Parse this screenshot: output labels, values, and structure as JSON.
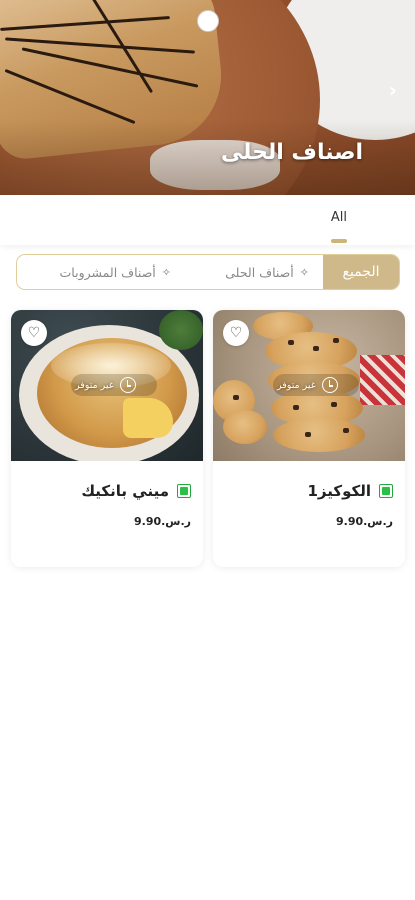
{
  "hero": {
    "title": "اصناف الحلى",
    "next_icon": "chevron-right-icon"
  },
  "tabs": [
    {
      "label": "All",
      "active": true
    }
  ],
  "filters": {
    "all_label": "الجميع",
    "items": [
      {
        "label": "أصناف الحلى",
        "icon": "sparkle-icon"
      },
      {
        "label": "أصناف المشروبات",
        "icon": "sparkle-icon"
      }
    ],
    "accent_color": "#cfb98a"
  },
  "products": [
    {
      "name": "ميني بانكيك",
      "price": "ر.س.9.90",
      "status": "غير متوفر",
      "veg_badge_color": "#2bbf45"
    },
    {
      "name": "الكوكيز1",
      "price": "ر.س.9.90",
      "status": "غير متوفر",
      "veg_badge_color": "#2bbf45"
    }
  ]
}
